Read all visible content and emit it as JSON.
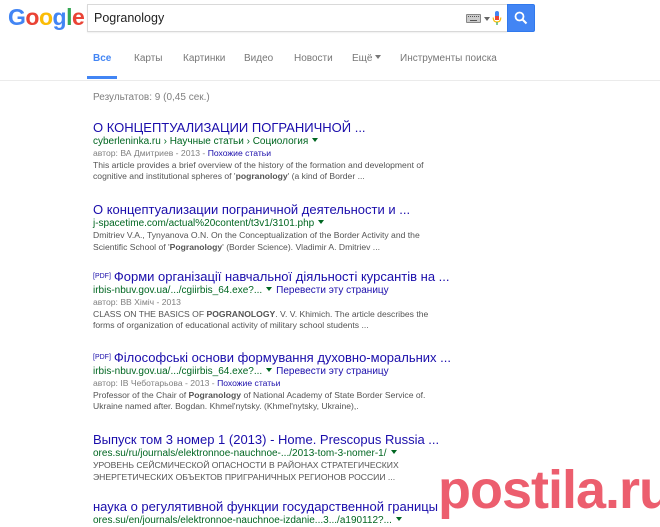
{
  "logo": {
    "text": "Google"
  },
  "search": {
    "query": "Pogranology"
  },
  "tabs": [
    {
      "label": "Все"
    },
    {
      "label": "Карты"
    },
    {
      "label": "Картинки"
    },
    {
      "label": "Видео"
    },
    {
      "label": "Новости"
    },
    {
      "label": "Ещё"
    },
    {
      "label": "Инструменты поиска"
    }
  ],
  "stats": "Результатов: 9 (0,45 сек.)",
  "results": [
    {
      "title": "О КОНЦЕПТУАЛИЗАЦИИ ПОГРАНИЧНОЙ ...",
      "url": "cyberleninka.ru › Научные статьи › Социология",
      "meta_prefix": "автор: ВА Дмитриев - 2013 - ",
      "meta_link": "Похожие статьи",
      "snippet_1": "This article provides a brief overview of the history of the formation and development of cognitive and institutional spheres of '",
      "snippet_bold": "pogranology",
      "snippet_2": "' (a kind of Border ..."
    },
    {
      "title": "О концептуализации пограничной деятельности и ...",
      "url": "j-spacetime.com/actual%20content/t3v1/3101.php",
      "snippet_1": "Dmitriev V.A., Tynyanova O.N. On the Conceptualization of the Border Activity and the Scientific School of '",
      "snippet_bold": "Pogranology",
      "snippet_2": "' (Border Science). Vladimir A. Dmitriev ..."
    },
    {
      "pdf": "[PDF]",
      "title": "Форми організації навчальної діяльності курсантів на ...",
      "url": "irbis-nbuv.gov.ua/.../cgiirbis_64.exe?...",
      "action": "Перевести эту страницу",
      "meta_prefix": "автор: ВВ Хіміч - 2013",
      "snippet_1": "CLASS ON THE BASICS OF ",
      "snippet_bold": "POGRANOLOGY",
      "snippet_2": ". V. V. Khimich. The article describes the forms of organization of educational activity of military school students ..."
    },
    {
      "pdf": "[PDF]",
      "title": "Філософські основи формування духовно-моральних ...",
      "url": "irbis-nbuv.gov.ua/.../cgiirbis_64.exe?...",
      "action": "Перевести эту страницу",
      "meta_prefix": "автор: ІВ Чеботарьова - 2013 - ",
      "meta_link": "Похожие статьи",
      "snippet_1": "Professor of the Chair of ",
      "snippet_bold": "Pogranology",
      "snippet_2": " of National Academy of State Border Service of. Ukraine named after. Bogdan. Khmel'nytsky. (Khmel'nytsky,  Ukraine),."
    },
    {
      "title": "Выпуск том 3 номер 1 (2013) - Home. Prescopus Russia ...",
      "url": "ores.su/ru/journals/elektronnoe-nauchnoe-.../2013-tom-3-nomer-1/",
      "snippet_1": "УРОВЕНЬ СЕЙСМИЧЕСКОЙ ОПАСНОСТИ В РАЙОНАХ СТРАТЕГИЧЕСКИХ ЭНЕРГЕТИЧЕСКИХ ОБЪЕКТОВ ПРИГРАНИЧНЫХ РЕГИОНОВ РОССИИ ...",
      "snippet_bold": "",
      "snippet_2": ""
    },
    {
      "title": "наука о регулятивной функции государственной границы",
      "url": "ores.su/en/journals/elektronnoe-nauchnoe-izdanie...3.../a190112?..."
    }
  ],
  "watermark": {
    "text": "postila.ru"
  },
  "colors": {
    "accent": "#4285f4",
    "link": "#1a0dab",
    "url": "#006621",
    "watermark": "#e8374a"
  },
  "icons": [
    "keyboard-icon",
    "microphone-icon",
    "search-icon"
  ]
}
